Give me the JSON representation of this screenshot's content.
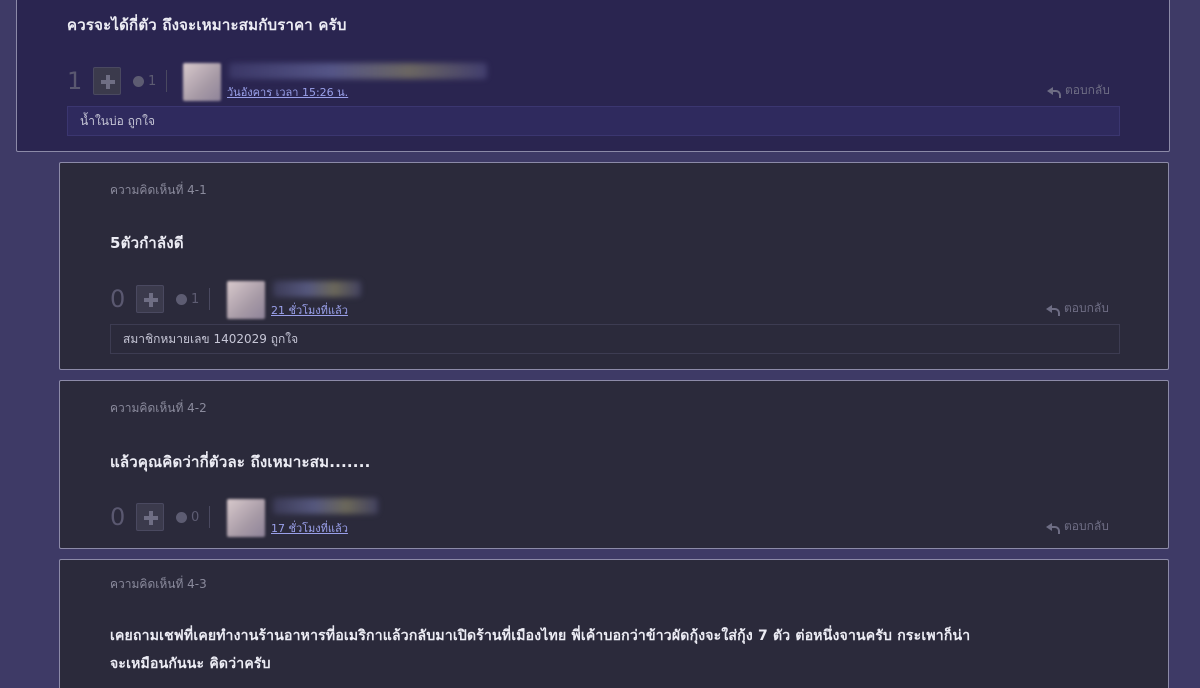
{
  "main_comment": {
    "text": "ควรจะได้กี่ตัว ถึงจะเหมาะสมกับราคา ครับ",
    "vote_count": "1",
    "emotion_count": "1",
    "timestamp": "วันอังคาร เวลา 15:26 น.",
    "reply_label": "ตอบกลับ",
    "likes_text": "น้ำในบ่อ ถูกใจ"
  },
  "replies": [
    {
      "label": "ความคิดเห็นที่ 4-1",
      "text": "5ตัวกำลังดี",
      "vote_count": "0",
      "emotion_count": "1",
      "timestamp": "21 ชั่วโมงที่แล้ว",
      "reply_label": "ตอบกลับ",
      "likes_text": "สมาชิกหมายเลข 1402029 ถูกใจ"
    },
    {
      "label": "ความคิดเห็นที่ 4-2",
      "text": "แล้วคุณคิดว่ากี่ตัวละ ถึงเหมาะสม.......",
      "vote_count": "0",
      "emotion_count": "0",
      "timestamp": "17 ชั่วโมงที่แล้ว",
      "reply_label": "ตอบกลับ"
    },
    {
      "label": "ความคิดเห็นที่ 4-3",
      "text_line1": "เคยถามเชฟที่เคยทำงานร้านอาหารที่อเมริกาแล้วกลับมาเปิดร้านที่เมืองไทย พี่เค้าบอกว่าข้าวผัดกุ้งจะใส่กุ้ง 7 ตัว ต่อหนึ่งจานครับ กระเพาก็น่า",
      "text_line2": "จะเหมือนกันนะ คิดว่าครับ"
    }
  ],
  "icons": {
    "plus": "plus-icon",
    "emotion": "emotion-icon",
    "reply": "reply-arrow-icon"
  }
}
